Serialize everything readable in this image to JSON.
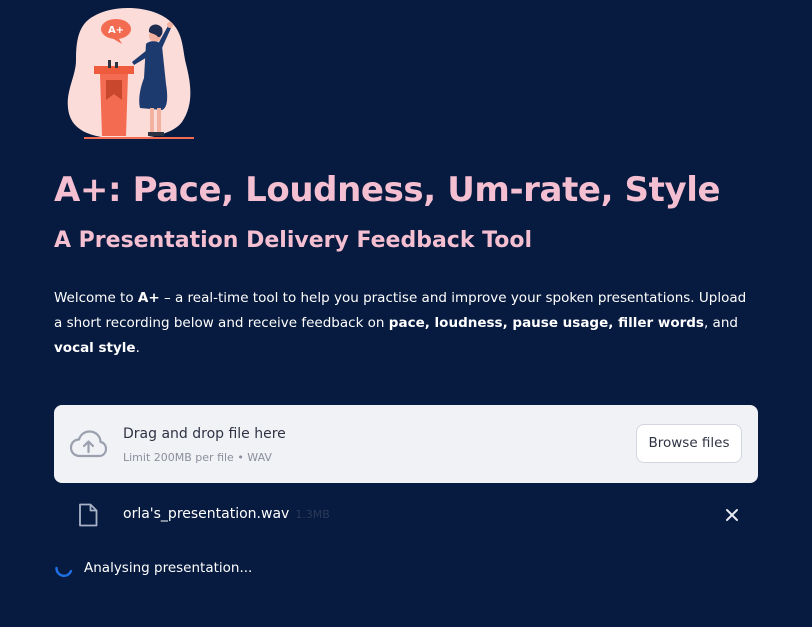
{
  "header": {
    "title": "A+: Pace, Loudness, Um-rate, Style",
    "subtitle": "A Presentation Delivery Feedback Tool",
    "hero_badge": "A+"
  },
  "intro": {
    "p1": "Welcome to ",
    "b1": "A+",
    "p2": " – a real-time tool to help you practise and improve your spoken presentations. Upload a short recording below and receive feedback on ",
    "b2": "pace, loudness, pause usage, filler words",
    "p3": ", and ",
    "b3": "vocal style",
    "p4": "."
  },
  "uploader": {
    "drop_text": "Drag and drop file here",
    "limit_text": "Limit 200MB per file • WAV",
    "browse_label": "Browse files",
    "icon": "cloud-upload-icon"
  },
  "file": {
    "name": "orla's_presentation.wav",
    "size": "1.3MB",
    "icon": "file-icon",
    "remove_icon": "close-icon"
  },
  "status": {
    "text": "Analysing presentation...",
    "icon": "spinner-icon"
  },
  "colors": {
    "background": "#071a3f",
    "title": "#f4bfd1",
    "uploader_bg": "#f0f2f6",
    "spinner": "#1f6fe5"
  }
}
